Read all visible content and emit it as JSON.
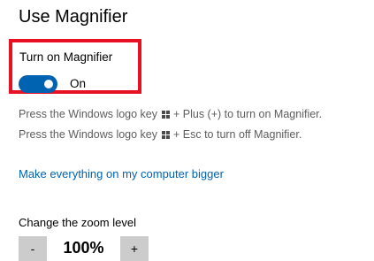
{
  "section": {
    "title": "Use Magnifier"
  },
  "magnifier_toggle": {
    "label": "Turn on Magnifier",
    "state": "On",
    "enabled": true,
    "accent_color": "#0063b1",
    "highlight_color": "#e81123"
  },
  "instructions": {
    "line1_prefix": "Press the Windows logo key",
    "line1_suffix": "+ Plus (+) to turn on Magnifier.",
    "line2_prefix": "Press the Windows logo key",
    "line2_suffix": "+ Esc to turn off Magnifier.",
    "icon": "windows-logo-icon"
  },
  "link": {
    "label": "Make everything on my computer bigger",
    "color": "#0063b1"
  },
  "zoom": {
    "label": "Change the zoom level",
    "value": "100%",
    "decrease_label": "-",
    "increase_label": "+"
  }
}
